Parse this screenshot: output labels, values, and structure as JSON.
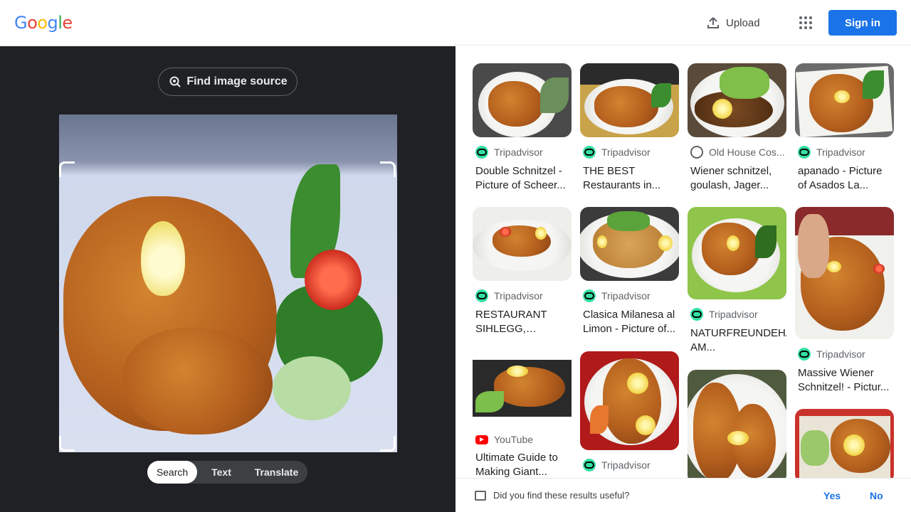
{
  "header": {
    "logo_letters": [
      "G",
      "o",
      "o",
      "g",
      "l",
      "e"
    ],
    "logo_colors": [
      "#4285f4",
      "#ea4335",
      "#fbbc05",
      "#4285f4",
      "#34a853",
      "#ea4335"
    ],
    "upload_label": "Upload",
    "signin_label": "Sign in"
  },
  "lens": {
    "find_source_label": "Find image source",
    "modes": [
      "Search",
      "Text",
      "Translate"
    ],
    "active_mode": "Search"
  },
  "results": [
    {
      "source": "Tripadvisor",
      "source_icon": "tripadvisor-icon",
      "title": "Double Schnitzel - Picture of Scheer..."
    },
    {
      "source": "Tripadvisor",
      "source_icon": "tripadvisor-icon",
      "title": "THE BEST Restaurants in..."
    },
    {
      "source": "Old House Cos...",
      "source_icon": "globe-icon",
      "title": "Wiener schnitzel, goulash, Jager..."
    },
    {
      "source": "Tripadvisor",
      "source_icon": "tripadvisor-icon",
      "title": "apanado - Picture of Asados La..."
    },
    {
      "source": "Tripadvisor",
      "source_icon": "tripadvisor-icon",
      "title": "RESTAURANT SIHLEGG, Wollera..."
    },
    {
      "source": "Tripadvisor",
      "source_icon": "tripadvisor-icon",
      "title": "Clasica Milanesa al Limon - Picture of..."
    },
    {
      "source": "Tripadvisor",
      "source_icon": "tripadvisor-icon",
      "title": "NATURFREUNDEHAUS AM..."
    },
    {
      "source": "Tripadvisor",
      "source_icon": "tripadvisor-icon",
      "title": "Massive Wiener Schnitzel! - Pictur..."
    },
    {
      "source": "YouTube",
      "source_icon": "youtube-icon",
      "title": "Ultimate Guide to Making Giant..."
    },
    {
      "source": "Tripadvisor",
      "source_icon": "tripadvisor-icon",
      "title": ""
    },
    {
      "source": "",
      "source_icon": "",
      "title": ""
    },
    {
      "source": "",
      "source_icon": "",
      "title": ""
    }
  ],
  "feedback": {
    "question": "Did you find these results useful?",
    "yes_label": "Yes",
    "no_label": "No"
  }
}
